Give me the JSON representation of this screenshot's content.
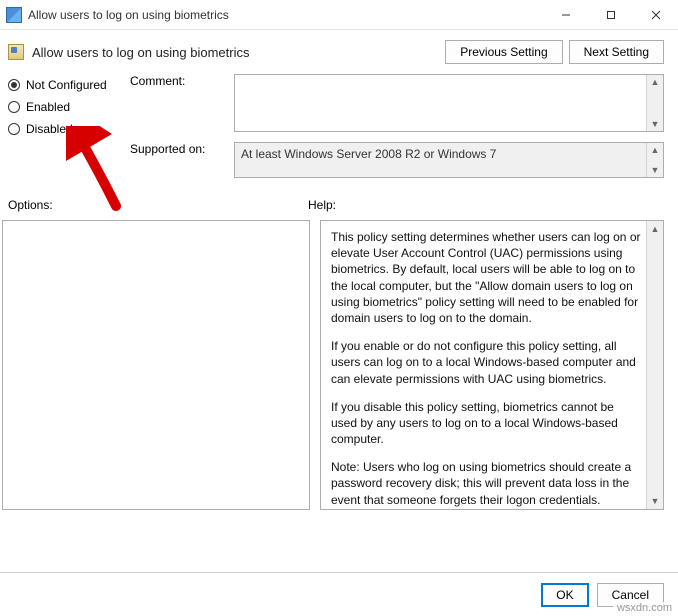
{
  "window": {
    "title": "Allow users to log on using biometrics"
  },
  "header": {
    "title": "Allow users to log on using biometrics",
    "prev_label": "Previous Setting",
    "next_label": "Next Setting"
  },
  "radios": {
    "not_configured": "Not Configured",
    "enabled": "Enabled",
    "disabled": "Disabled",
    "selected": "not_configured"
  },
  "labels": {
    "comment": "Comment:",
    "supported_on": "Supported on:",
    "options": "Options:",
    "help": "Help:"
  },
  "supported_text": "At least Windows Server 2008 R2 or Windows 7",
  "help": {
    "p1": "This policy setting determines whether users can log on or elevate User Account Control (UAC) permissions using biometrics.  By default, local users will be able to log on to the local computer, but the \"Allow domain users to log on using biometrics\" policy setting will need to be enabled for domain users to log on to the domain.",
    "p2": "If you enable or do not configure this policy setting, all users can log on to a local Windows-based computer and can elevate permissions with UAC using biometrics.",
    "p3": "If you disable this policy setting, biometrics cannot be used by any users to log on to a local Windows-based computer.",
    "p4": "Note: Users who log on using biometrics should create a password recovery disk; this will prevent data loss in the event that someone forgets their logon credentials."
  },
  "footer": {
    "ok": "OK",
    "cancel": "Cancel"
  },
  "watermark": "wsxdn.com"
}
